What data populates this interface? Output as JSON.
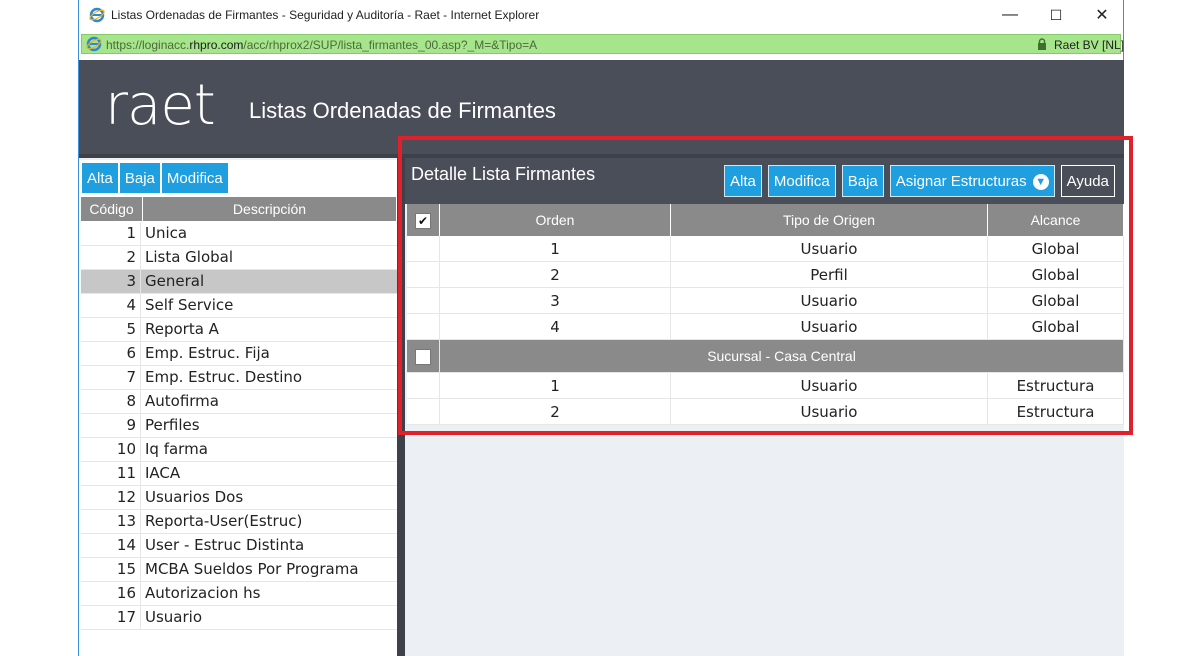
{
  "window": {
    "title": "Listas Ordenadas de Firmantes - Seguridad y Auditoría - Raet - Internet Explorer",
    "url_prefix": "https://loginacc.",
    "url_domain": "rhpro.com",
    "url_path": "/acc/rhprox2/SUP/lista_firmantes_00.asp?_M=&Tipo=A",
    "cert": "Raet BV [NL]",
    "minimize": "—",
    "maximize": "☐",
    "close": "✕"
  },
  "header": {
    "logo": "raet",
    "title": "Listas Ordenadas de Firmantes"
  },
  "left": {
    "buttons": [
      "Alta",
      "Baja",
      "Modifica"
    ],
    "columns": [
      "Código",
      "Descripción"
    ],
    "rows": [
      {
        "code": "1",
        "desc": "Unica"
      },
      {
        "code": "2",
        "desc": "Lista Global"
      },
      {
        "code": "3",
        "desc": "General"
      },
      {
        "code": "4",
        "desc": "Self Service"
      },
      {
        "code": "5",
        "desc": "Reporta A"
      },
      {
        "code": "6",
        "desc": "Emp. Estruc. Fija"
      },
      {
        "code": "7",
        "desc": "Emp. Estruc. Destino"
      },
      {
        "code": "8",
        "desc": "Autofirma"
      },
      {
        "code": "9",
        "desc": "Perfiles"
      },
      {
        "code": "10",
        "desc": "Iq farma"
      },
      {
        "code": "11",
        "desc": "IACA"
      },
      {
        "code": "12",
        "desc": "Usuarios Dos"
      },
      {
        "code": "13",
        "desc": "Reporta-User(Estruc)"
      },
      {
        "code": "14",
        "desc": "User - Estruc Distinta"
      },
      {
        "code": "15",
        "desc": "MCBA Sueldos Por Programa"
      },
      {
        "code": "16",
        "desc": "Autorizacion hs"
      },
      {
        "code": "17",
        "desc": "Usuario"
      }
    ],
    "selected_code": "3"
  },
  "detail": {
    "title": "Detalle Lista Firmantes",
    "buttons": {
      "alta": "Alta",
      "modifica": "Modifica",
      "baja": "Baja",
      "asignar": "Asignar Estructuras",
      "ayuda": "Ayuda"
    },
    "columns": [
      "Orden",
      "Tipo de Origen",
      "Alcance"
    ],
    "header_check": "✔",
    "rows_a": [
      {
        "orden": "1",
        "tipo": "Usuario",
        "alcance": "Global"
      },
      {
        "orden": "2",
        "tipo": "Perfil",
        "alcance": "Global"
      },
      {
        "orden": "3",
        "tipo": "Usuario",
        "alcance": "Global"
      },
      {
        "orden": "4",
        "tipo": "Usuario",
        "alcance": "Global"
      }
    ],
    "group_label": "Sucursal - Casa Central",
    "rows_b": [
      {
        "orden": "1",
        "tipo": "Usuario",
        "alcance": "Estructura"
      },
      {
        "orden": "2",
        "tipo": "Usuario",
        "alcance": "Estructura"
      }
    ]
  },
  "colors": {
    "accent": "#1f9ee0",
    "header": "#4a4e58",
    "highlight": "#e0202a",
    "address_bar": "#a6e58b"
  }
}
